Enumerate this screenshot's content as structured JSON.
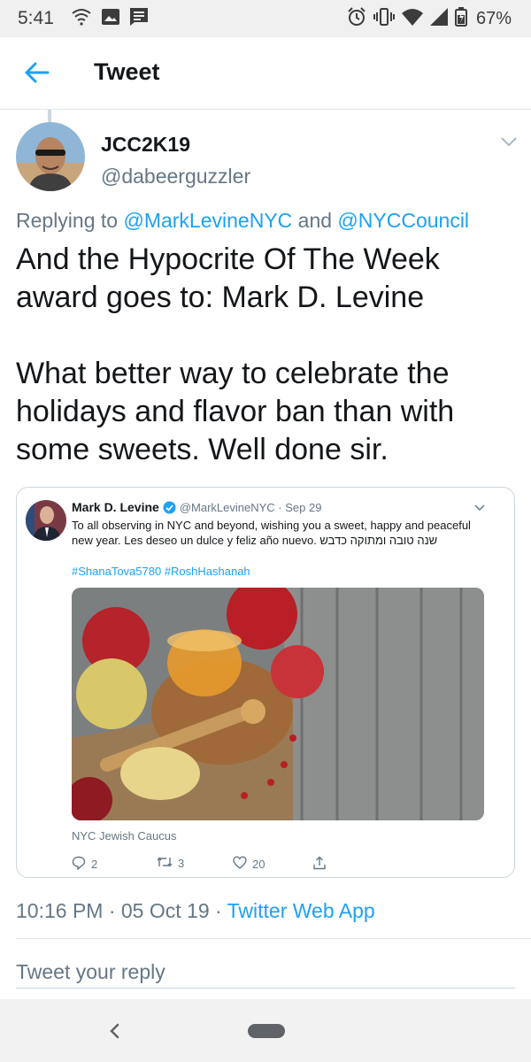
{
  "status_bar": {
    "time": "5:41",
    "battery": "67%"
  },
  "header": {
    "title": "Tweet"
  },
  "tweet": {
    "display_name": "JCC2K19",
    "handle": "@dabeerguzzler",
    "replying_prefix": "Replying to ",
    "replying_mention_1": "@MarkLevineNYC",
    "replying_joiner": " and ",
    "replying_mention_2": "@NYCCouncil",
    "body_line_1": "And the Hypocrite Of The Week award goes to: Mark D. Levine",
    "body_line_2": "What better way to celebrate the holidays and flavor ban than with some sweets. Well done sir.",
    "timestamp": "10:16 PM · 05 Oct 19 · ",
    "via": "Twitter Web App"
  },
  "quoted_tweet": {
    "name": "Mark D. Levine",
    "handle": "@MarkLevineNYC · Sep 29",
    "text": "To all observing in NYC and beyond, wishing you a sweet, happy and peaceful new year. Les deseo un dulce y feliz año nuevo.  שנה טובה ומתוקה כדבש",
    "hashtags": "#ShanaTova5780 #RoshHashanah",
    "source": "NYC Jewish Caucus",
    "replies": "2",
    "retweets": "3",
    "likes": "20"
  },
  "composer": {
    "placeholder": "Tweet your reply"
  },
  "colors": {
    "accent": "#1da1f2",
    "secondary_text": "#657786",
    "primary_text": "#14171a"
  }
}
